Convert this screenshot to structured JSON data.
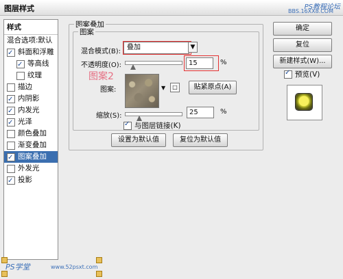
{
  "window": {
    "title": "图层样式",
    "watermark_top": "PS教程论坛",
    "watermark_top_url": "BBS.16XX8.COM",
    "watermark_bottom": "PS学堂",
    "watermark_bottom_url": "www.52psxt.com"
  },
  "sidebar": {
    "title": "样式",
    "items": [
      {
        "label": "混合选项:默认",
        "checked": null
      },
      {
        "label": "斜面和浮雕",
        "checked": true
      },
      {
        "label": "等高线",
        "checked": true,
        "sub": true
      },
      {
        "label": "纹理",
        "checked": false,
        "sub": true
      },
      {
        "label": "描边",
        "checked": false
      },
      {
        "label": "内阴影",
        "checked": true
      },
      {
        "label": "内发光",
        "checked": true
      },
      {
        "label": "光泽",
        "checked": true
      },
      {
        "label": "颜色叠加",
        "checked": false
      },
      {
        "label": "渐变叠加",
        "checked": false
      },
      {
        "label": "图案叠加",
        "checked": true,
        "active": true
      },
      {
        "label": "外发光",
        "checked": false
      },
      {
        "label": "投影",
        "checked": true
      }
    ]
  },
  "main": {
    "group_title": "图案叠加",
    "subgroup_title": "图案",
    "blend_label": "混合模式(B):",
    "blend_value": "叠加",
    "opacity_label": "不透明度(O):",
    "opacity_value": "15",
    "opacity_percent": "%",
    "annotation": "图案2",
    "pattern_label": "图案:",
    "snap_button": "贴紧原点(A)",
    "scale_label": "缩放(S):",
    "scale_value": "25",
    "scale_percent": "%",
    "link_label": "与图层链接(K)",
    "set_default": "设置为默认值",
    "reset_default": "复位为默认值"
  },
  "sliders": {
    "opacity_level": 0.15,
    "scale_level": 0.25
  },
  "right_panel": {
    "ok": "确定",
    "reset": "复位",
    "new_style": "新建样式(W)...",
    "preview_label": "预览(V)"
  },
  "colors": {
    "selection": "#3b6fb0",
    "annotation_red": "#e43131",
    "annotation_pink": "#e66f83"
  }
}
